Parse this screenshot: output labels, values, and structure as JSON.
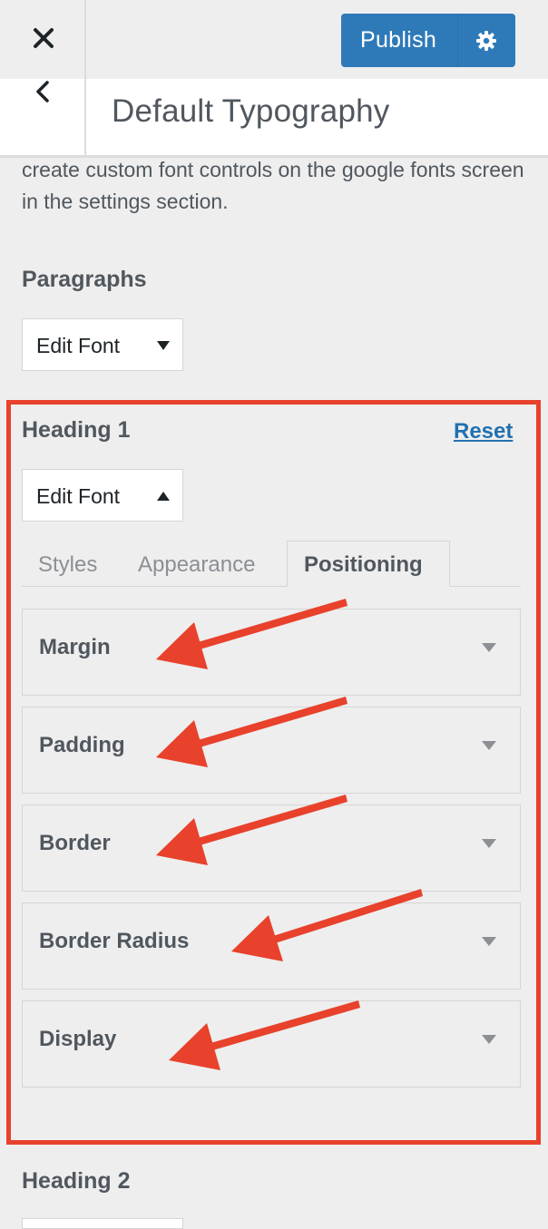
{
  "topbar": {
    "close_icon": "close-icon",
    "publish_label": "Publish",
    "settings_icon": "gear-icon",
    "accent_color": "#2e7ab8"
  },
  "section": {
    "back_icon": "chevron-left-icon",
    "title": "Default Typography"
  },
  "description": "create custom font controls on the google fonts screen in the settings section.",
  "controls": {
    "paragraphs": {
      "title": "Paragraphs",
      "edit_font_label": "Edit Font",
      "expanded": false
    },
    "heading1": {
      "title": "Heading 1",
      "reset_label": "Reset",
      "edit_font_label": "Edit Font",
      "expanded": true,
      "tabs": [
        {
          "label": "Styles",
          "active": false
        },
        {
          "label": "Appearance",
          "active": false
        },
        {
          "label": "Positioning",
          "active": true
        }
      ],
      "panels": [
        {
          "label": "Margin"
        },
        {
          "label": "Padding"
        },
        {
          "label": "Border"
        },
        {
          "label": "Border Radius"
        },
        {
          "label": "Display"
        }
      ]
    },
    "heading2": {
      "title": "Heading 2"
    }
  },
  "annotation": {
    "highlight_color": "#e8412c"
  }
}
